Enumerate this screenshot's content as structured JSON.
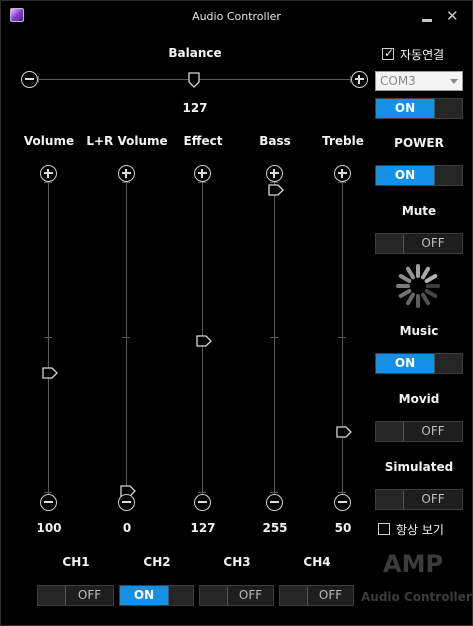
{
  "window": {
    "title": "Audio Controller"
  },
  "balance": {
    "label": "Balance",
    "value": "127",
    "level": 127,
    "max": 255
  },
  "sliders": [
    {
      "label": "Volume",
      "value": "100",
      "level": 100,
      "max": 255
    },
    {
      "label": "L+R Volume",
      "value": "0",
      "level": 0,
      "max": 255
    },
    {
      "label": "Effect",
      "value": "127",
      "level": 127,
      "max": 255
    },
    {
      "label": "Bass",
      "value": "255",
      "level": 255,
      "max": 255
    },
    {
      "label": "Treble",
      "value": "50",
      "level": 50,
      "max": 255
    }
  ],
  "right_panel": {
    "auto_connect_label": "자동연결",
    "auto_connect_checked": true,
    "port": "COM3",
    "connect_toggle": "ON",
    "power_label": "POWER",
    "power_toggle": "ON",
    "mute_label": "Mute",
    "mute_toggle": "OFF",
    "music_label": "Music",
    "music_toggle": "ON",
    "movid_label": "Movid",
    "movid_toggle": "OFF",
    "simulated_label": "Simulated",
    "simulated_toggle": "OFF",
    "always_on_top_label": "항상 보기",
    "always_on_top_checked": false
  },
  "channels": [
    {
      "label": "CH1",
      "state": "OFF"
    },
    {
      "label": "CH2",
      "state": "ON"
    },
    {
      "label": "CH3",
      "state": "OFF"
    },
    {
      "label": "CH4",
      "state": "OFF"
    }
  ],
  "brand": {
    "amp": "AMP",
    "sub": "Audio Controller"
  },
  "colors": {
    "accent": "#1490e6",
    "background": "#000000",
    "brand_text": "#3c3c3c"
  }
}
